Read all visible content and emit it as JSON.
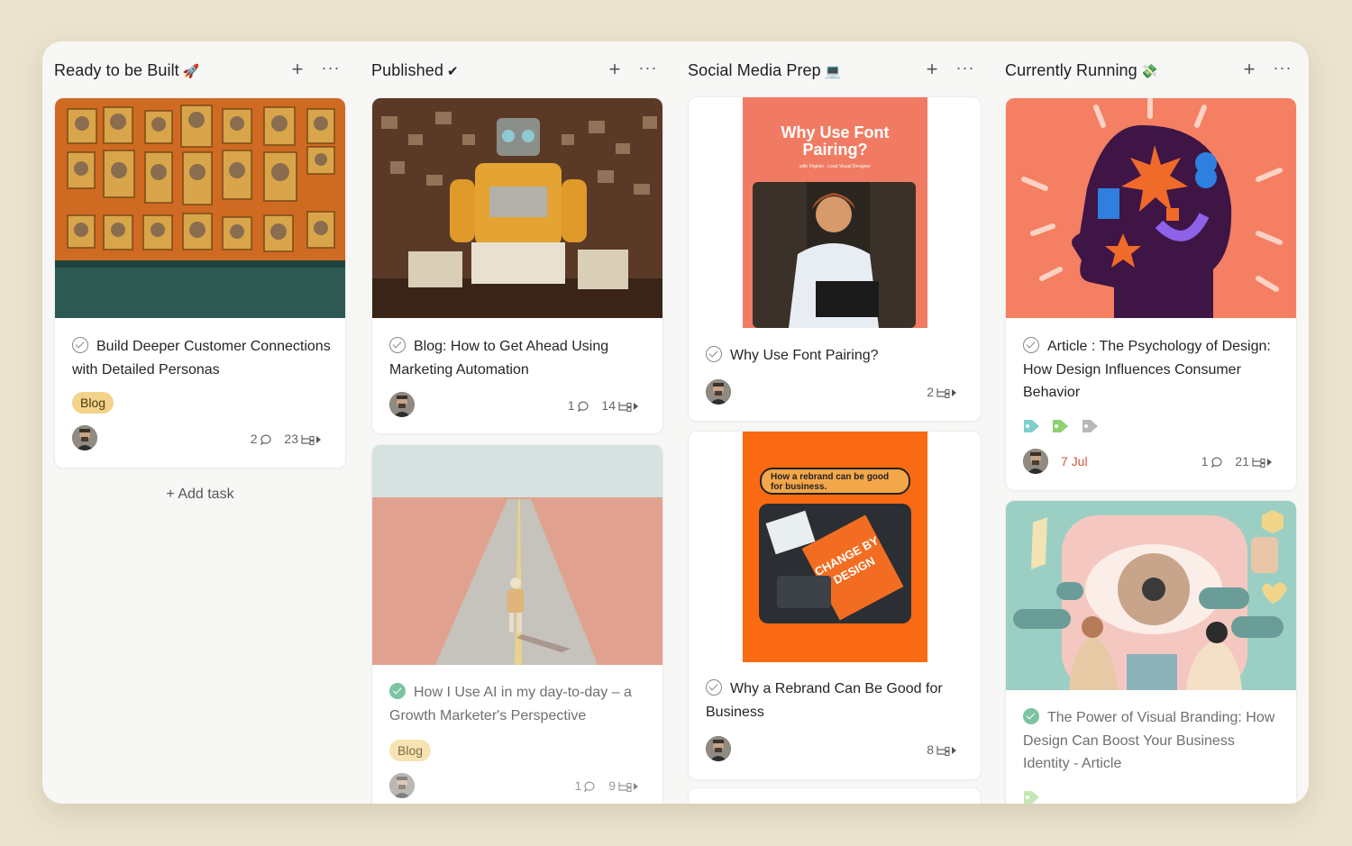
{
  "columns": [
    {
      "title": "Ready to be Built",
      "icon": "rocket-icon",
      "cards": [
        {
          "title": "Build Deeper Customer Connections with Detailed Personas",
          "tag": "Blog",
          "comments": "2",
          "subtasks": "23"
        }
      ],
      "add_task": "+ Add task"
    },
    {
      "title": "Published",
      "icon": "checkmark-icon",
      "cards": [
        {
          "title": "Blog: How to Get Ahead Using Marketing Automation",
          "comments": "1",
          "subtasks": "14"
        },
        {
          "title": "How I Use AI in my day-to-day – a Growth Marketer's Perspective",
          "tag": "Blog",
          "comments": "1",
          "subtasks": "9"
        }
      ]
    },
    {
      "title": "Social Media Prep",
      "icon": "laptop-icon",
      "cards": [
        {
          "title": "Why Use Font Pairing?",
          "subtasks": "2",
          "cover_heading": "Why Use Font Pairing?",
          "cover_sub": "with Virginie - Lead Visual Designer"
        },
        {
          "title": "Why a Rebrand Can Be Good for Business",
          "subtasks": "8",
          "cover_banner": "How a rebrand can be good for business.",
          "cover_book": "CHANGE BY DESIGN"
        }
      ]
    },
    {
      "title": "Currently Running",
      "icon": "money-wings-icon",
      "cards": [
        {
          "title": "Article : The Psychology of Design: How Design Influences Consumer Behavior",
          "date": "7 Jul",
          "comments": "1",
          "subtasks": "21"
        },
        {
          "title": "The Power of Visual Branding: How Design Can Boost Your Business Identity - Article"
        }
      ]
    }
  ],
  "header_actions": {
    "add": "+",
    "more": "···"
  },
  "colors": {
    "tag_blog": "#f3d38a",
    "date_red": "#d2553b",
    "done_green": "#7bc4a2"
  }
}
